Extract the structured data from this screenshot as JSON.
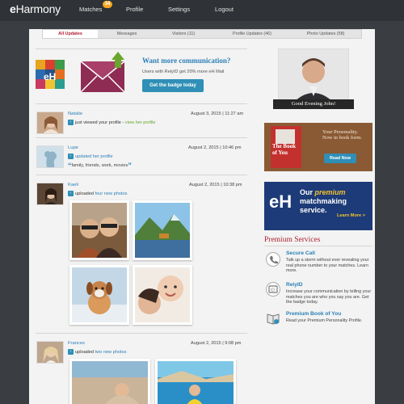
{
  "nav": {
    "logo_bold": "e",
    "logo_rest": "Harmony",
    "items": [
      {
        "label": "Matches",
        "badge": "34"
      },
      {
        "label": "Profile"
      },
      {
        "label": "Settings"
      },
      {
        "label": "Logout"
      }
    ]
  },
  "tabs": [
    {
      "label": "All Updates",
      "active": true
    },
    {
      "label": "Messages"
    },
    {
      "label": "Visitors (11)"
    },
    {
      "label": "Profile Updates (46)"
    },
    {
      "label": "Photo Updates (58)"
    }
  ],
  "promo": {
    "title": "Want more communication?",
    "text": "Users with RelyID get 20% more eH Mail",
    "button": "Get the badge today",
    "logo_text": "eH"
  },
  "feed": [
    {
      "name": "Natalie",
      "date": "August 3, 2015",
      "time": "11:27 am",
      "activity": "just viewed your profile - ",
      "link": "view her profile"
    },
    {
      "name": "Lupe",
      "date": "August 2, 2015",
      "time": "10:46 pm",
      "activity": "updated her profile",
      "interests": "family, friends, work, movies"
    },
    {
      "name": "Kaeli",
      "date": "August 2, 2015",
      "time": "10:38 pm",
      "activity_prefix": "uploaded ",
      "activity_link": "four new photos"
    },
    {
      "name": "Frances",
      "date": "August 2, 2015",
      "time": "9:08 pm",
      "activity_prefix": "uploaded ",
      "activity_link": "two new photos"
    }
  ],
  "sidebar": {
    "greeting": "Good Evening John!",
    "book_ad": {
      "title_line1": "The",
      "title_line2": "Book",
      "title_line3": "of",
      "title_line4": "You",
      "tagline": "Your Personality. Now in book form.",
      "button": "Read Now"
    },
    "eh_ad": {
      "logo": "eH",
      "line1": "Our",
      "line1_em": "premium",
      "line2": "matchmaking",
      "line3": "service.",
      "link": "Learn More >"
    },
    "premium_title": "Premium Services",
    "services": [
      {
        "icon": "phone-icon",
        "title": "Secure Call",
        "desc": "Talk up a storm without ever revealing your real phone number to your matches. Learn more."
      },
      {
        "icon": "id-badge-icon",
        "title": "RelyID",
        "desc": "Increase your communication by telling your matches you are who you say you are. Get the badge today."
      },
      {
        "icon": "book-icon",
        "title": "Premium Book of You",
        "desc": "Read your Premium Personality Profile."
      }
    ]
  },
  "colors": {
    "accent_blue": "#2c7fb8",
    "brand_red": "#b01e2f",
    "nav_bg": "#2f3236",
    "badge_orange": "#f5a623"
  }
}
